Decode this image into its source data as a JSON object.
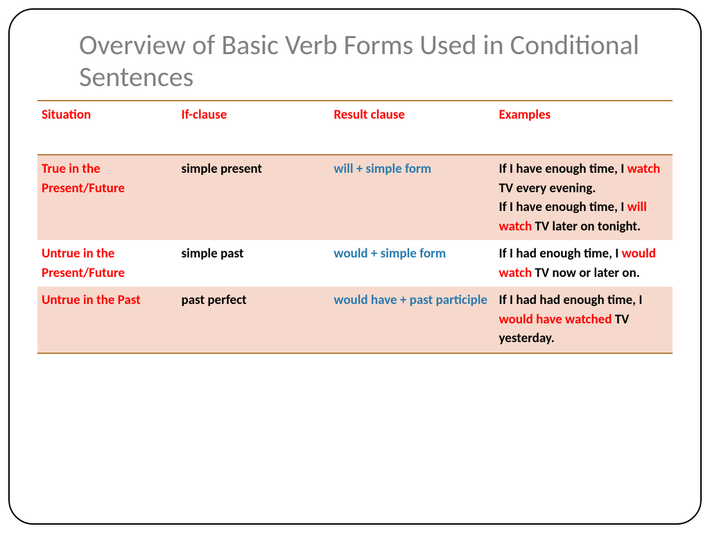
{
  "title": "Overview of Basic Verb Forms Used in Conditional Sentences",
  "headers": {
    "situation": "Situation",
    "ifclause": "If-clause",
    "result": "Result clause",
    "examples": "Examples"
  },
  "rows": [
    {
      "situation": "True in the Present/Future",
      "ifclause": "simple present",
      "result": "will + simple form",
      "ex": {
        "p1a": "If I have enough time, I ",
        "p1h": "watch",
        "p1b": " TV every evening.",
        "p2a": "If I have enough time, I ",
        "p2h": "will watch",
        "p2b": " TV later on tonight."
      }
    },
    {
      "situation": "Untrue in the Present/Future",
      "ifclause": "simple past",
      "result": "would + simple form",
      "ex": {
        "p1a": "If I had enough time, I ",
        "p1h": "would watch",
        "p1b": " TV now or later on."
      }
    },
    {
      "situation": "Untrue in the Past",
      "ifclause": "past perfect",
      "result": "would have + past participle",
      "ex": {
        "p1a": "If I had had enough time, I ",
        "p1h": "would have watched",
        "p1b": " TV yesterday."
      }
    }
  ]
}
